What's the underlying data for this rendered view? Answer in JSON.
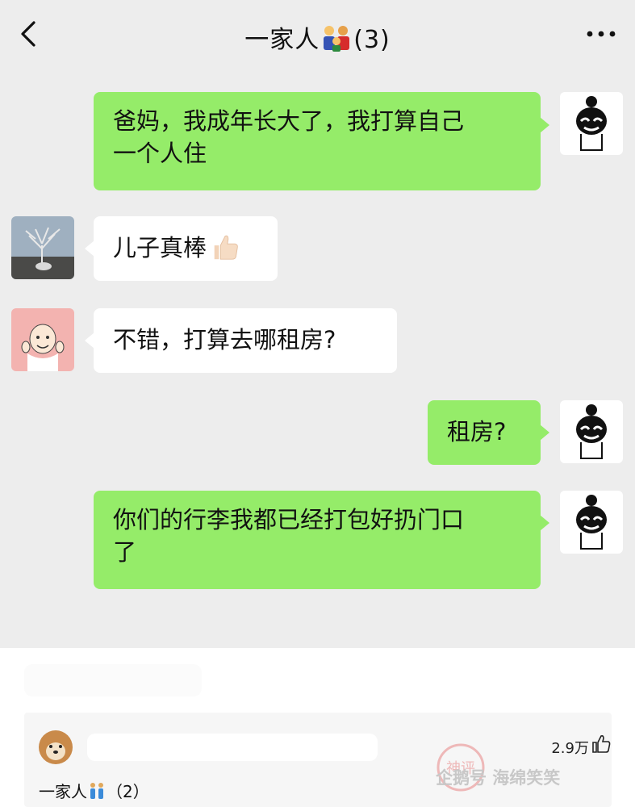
{
  "header": {
    "title": "一家人",
    "count": "(3)",
    "back_icon": "chevron-left-icon",
    "more_icon": "more-dots-icon"
  },
  "messages": [
    {
      "from": "me",
      "text_line1": "爸妈，我成年长大了，我打算自己",
      "text_line2": "一个人住"
    },
    {
      "from": "dad",
      "text": "儿子真棒"
    },
    {
      "from": "mom",
      "text": "不错，打算去哪租房?"
    },
    {
      "from": "me",
      "text": "租房?"
    },
    {
      "from": "me",
      "text_line1": "你们的行李我都已经打包好扔门口",
      "text_line2": "了"
    }
  ],
  "footer": {
    "likes": "2.9万",
    "group_label": "一家人",
    "group_count": "（2）",
    "watermark": "企鹅号 海绵笑笑",
    "stamp": "神评"
  },
  "colors": {
    "chat_bg": "#ededed",
    "outgoing_bubble": "#95ec69",
    "incoming_bubble": "#ffffff"
  }
}
